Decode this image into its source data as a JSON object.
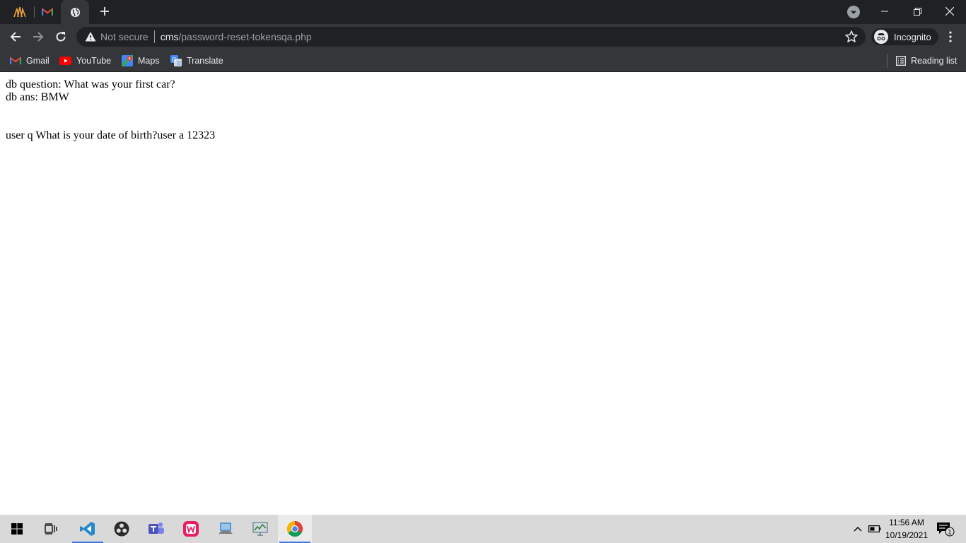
{
  "browser": {
    "omnibox": {
      "security_label": "Not secure",
      "url_host": "cms",
      "url_path": "/password-reset-tokensqa.php"
    },
    "profile_label": "Incognito"
  },
  "bookmarks": {
    "items": [
      {
        "label": "Gmail",
        "icon": "gmail-icon"
      },
      {
        "label": "YouTube",
        "icon": "youtube-icon"
      },
      {
        "label": "Maps",
        "icon": "maps-icon"
      },
      {
        "label": "Translate",
        "icon": "translate-icon"
      }
    ],
    "reading_list": "Reading list"
  },
  "page": {
    "line1": "db question: What was your first car?",
    "line2": "db ans: BMW",
    "line3": "user q What is your date of birth?user a 12323"
  },
  "taskbar": {
    "time": "11:56 AM",
    "date": "10/19/2021",
    "notification_count": "1"
  },
  "colors": {
    "titlebar": "#202124",
    "toolbar": "#35363a",
    "taskbar": "#d9d9d9",
    "accent": "#3b78e7"
  }
}
